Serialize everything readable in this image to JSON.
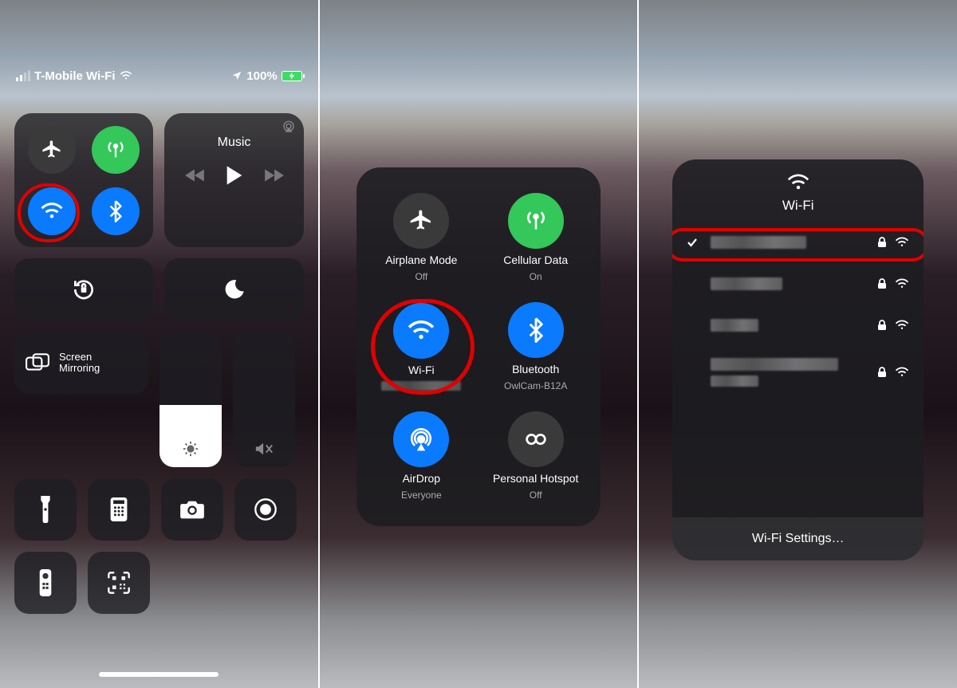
{
  "status": {
    "carrier": "T-Mobile Wi-Fi",
    "battery": "100%"
  },
  "panel1": {
    "music_label": "Music",
    "screen_mirroring": "Screen\nMirroring"
  },
  "panel2": {
    "items": [
      {
        "label": "Airplane Mode",
        "sub": "Off"
      },
      {
        "label": "Cellular Data",
        "sub": "On"
      },
      {
        "label": "Wi-Fi",
        "sub": ""
      },
      {
        "label": "Bluetooth",
        "sub": "OwlCam-B12A"
      },
      {
        "label": "AirDrop",
        "sub": "Everyone"
      },
      {
        "label": "Personal Hotspot",
        "sub": "Off"
      }
    ]
  },
  "panel3": {
    "title": "Wi-Fi",
    "settings_label": "Wi-Fi Settings…"
  }
}
